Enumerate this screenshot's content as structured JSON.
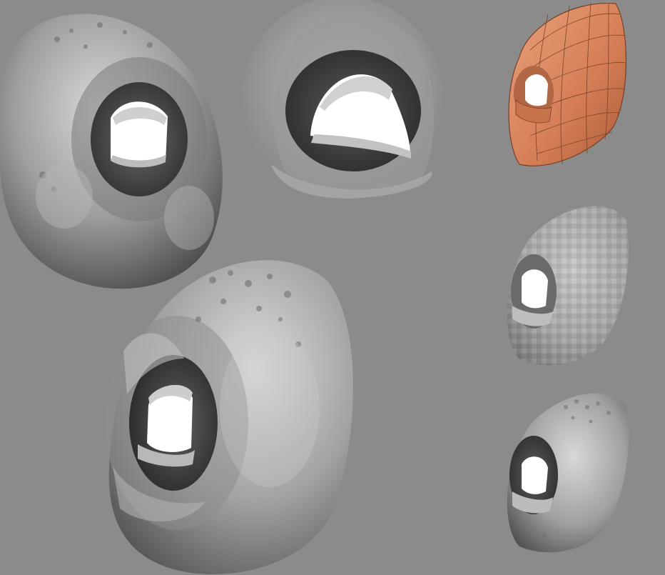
{
  "scene": {
    "background": "#8b8b8b",
    "render_count": 6,
    "renders": [
      {
        "label": "sculpt-closeup-front",
        "material": "grey-clay",
        "detail": "high"
      },
      {
        "label": "mouth-interior-closeup",
        "material": "grey-clay",
        "detail": "high",
        "soft_edges": true
      },
      {
        "label": "base-mesh-lowpoly",
        "material": "orange-clay",
        "detail": "low",
        "wireframe": true
      },
      {
        "label": "sculpt-large-threequarter",
        "material": "grey-clay",
        "detail": "high"
      },
      {
        "label": "subdivided-mesh-polygroups",
        "material": "grey-clay",
        "detail": "medium"
      },
      {
        "label": "final-sculpt-small",
        "material": "grey-clay",
        "detail": "high"
      }
    ],
    "colors": {
      "clay_grey": "#a8a8a8",
      "clay_shadow": "#4a4a4a",
      "clay_highlight": "#e0e0e0",
      "base_mesh_orange": "#d9855e",
      "mouth_cavity": "#ffffff"
    }
  }
}
